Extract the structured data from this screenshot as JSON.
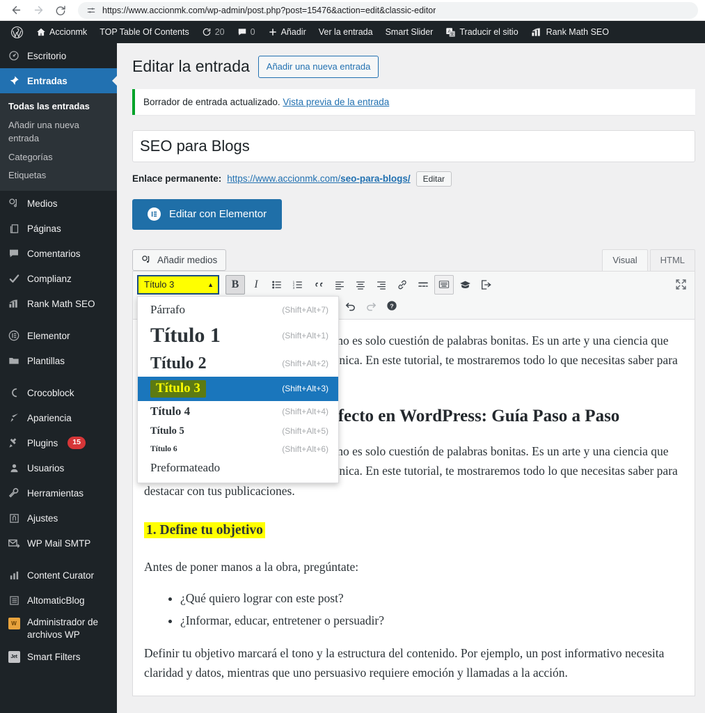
{
  "browser": {
    "url": "https://www.accionmk.com/wp-admin/post.php?post=15476&action=edit&classic-editor",
    "back_icon": "arrow-left-icon",
    "forward_icon": "arrow-right-icon",
    "reload_icon": "reload-icon",
    "site_settings_icon": "site-settings-icon"
  },
  "adminbar": {
    "items": [
      {
        "label": "",
        "icon": "wordpress-logo-icon"
      },
      {
        "label": "Accionmk",
        "icon": "home-icon"
      },
      {
        "label": "TOP Table Of Contents",
        "icon": ""
      },
      {
        "label": "20",
        "icon": "update-icon"
      },
      {
        "label": "0",
        "icon": "comment-icon"
      },
      {
        "label": "Añadir",
        "icon": "plus-icon"
      },
      {
        "label": "Ver la entrada",
        "icon": ""
      },
      {
        "label": "Smart Slider",
        "icon": ""
      },
      {
        "label": "Traducir el sitio",
        "icon": "translate-icon"
      },
      {
        "label": "Rank Math SEO",
        "icon": "rankmath-icon"
      }
    ]
  },
  "sidebar": {
    "items": [
      {
        "label": "Escritorio",
        "icon": "dashboard-icon"
      },
      {
        "label": "Entradas",
        "icon": "pin-icon",
        "current": true
      },
      {
        "label": "Medios",
        "icon": "media-icon"
      },
      {
        "label": "Páginas",
        "icon": "pages-icon"
      },
      {
        "label": "Comentarios",
        "icon": "comment-icon"
      },
      {
        "label": "Complianz",
        "icon": "check-icon"
      },
      {
        "label": "Rank Math SEO",
        "icon": "rankmath-icon"
      },
      {
        "label": "Elementor",
        "icon": "elementor-icon"
      },
      {
        "label": "Plantillas",
        "icon": "folder-icon"
      },
      {
        "label": "Crocoblock",
        "icon": "crocoblock-icon"
      },
      {
        "label": "Apariencia",
        "icon": "brush-icon"
      },
      {
        "label": "Plugins",
        "icon": "plug-icon",
        "badge": "15"
      },
      {
        "label": "Usuarios",
        "icon": "user-icon"
      },
      {
        "label": "Herramientas",
        "icon": "wrench-icon"
      },
      {
        "label": "Ajustes",
        "icon": "settings-icon"
      },
      {
        "label": "WP Mail SMTP",
        "icon": "mail-icon"
      },
      {
        "label": "Content Curator",
        "icon": "bars-chart-icon"
      },
      {
        "label": "AltomaticBlog",
        "icon": "list-icon"
      },
      {
        "label": "Administrador de archivos WP",
        "icon": "wp-folder-icon"
      },
      {
        "label": "Smart Filters",
        "icon": "jet-icon"
      }
    ],
    "submenu": [
      {
        "label": "Todas las entradas",
        "current": true
      },
      {
        "label": "Añadir una nueva entrada"
      },
      {
        "label": "Categorías"
      },
      {
        "label": "Etiquetas"
      }
    ]
  },
  "page": {
    "title": "Editar la entrada",
    "add_new_button": "Añadir una nueva entrada",
    "notice_text": "Borrador de entrada actualizado.",
    "notice_link": "Vista previa de la entrada",
    "post_title": "SEO para Blogs",
    "permalink_label": "Enlace permanente:",
    "permalink_prefix": "https://www.accionmk.com/",
    "permalink_slug": "seo-para-blogs/",
    "permalink_edit_button": "Editar",
    "elementor_button": "Editar con Elementor"
  },
  "editor": {
    "add_media_button": "Añadir medios",
    "tabs": [
      {
        "label": "Visual",
        "active": true
      },
      {
        "label": "HTML",
        "active": false
      }
    ],
    "format_select_value": "Título 3",
    "format_options": [
      {
        "label": "Párrafo",
        "shortcut": "(Shift+Alt+7)",
        "style": "o-para",
        "selected": false
      },
      {
        "label": "Título 1",
        "shortcut": "(Shift+Alt+1)",
        "style": "o-h1",
        "selected": false
      },
      {
        "label": "Título 2",
        "shortcut": "(Shift+Alt+2)",
        "style": "o-h2",
        "selected": false
      },
      {
        "label": "Título 3",
        "shortcut": "(Shift+Alt+3)",
        "style": "o-h3",
        "selected": true
      },
      {
        "label": "Título 4",
        "shortcut": "(Shift+Alt+4)",
        "style": "o-h4",
        "selected": false
      },
      {
        "label": "Título 5",
        "shortcut": "(Shift+Alt+5)",
        "style": "o-h5",
        "selected": false
      },
      {
        "label": "Título 6",
        "shortcut": "(Shift+Alt+6)",
        "style": "o-h6",
        "selected": false
      },
      {
        "label": "Preformateado",
        "shortcut": "",
        "style": "o-pre",
        "selected": false
      }
    ],
    "toolbar_icons": [
      "bold-icon",
      "italic-icon",
      "bulleted-list-icon",
      "numbered-list-icon",
      "blockquote-icon",
      "align-left-icon",
      "align-center-icon",
      "align-right-icon",
      "link-icon",
      "read-more-icon",
      "toolbar-toggle-icon",
      "graduation-cap-icon",
      "logout-icon",
      "fullscreen-icon"
    ],
    "toolbar_row2_icons": [
      "undo-icon",
      "redo-icon",
      "help-icon"
    ]
  },
  "content": {
    "paragraph_1": "Escribir un post perfecto en WordPress no es solo cuestión de palabras bonitas. Es un arte y una ciencia que combina creatividad, planificación y técnica. En este tutorial, te mostraremos todo lo que necesitas saber para destacar con tus publicaciones.",
    "heading_2": "Cómo escribir un post perfecto en WordPress: Guía Paso a Paso",
    "paragraph_2": "Escribir un post perfecto en WordPress no es solo cuestión de palabras bonitas. Es un arte y una ciencia que combina creatividad, planificación y técnica. En este tutorial, te mostraremos todo lo que necesitas saber para destacar con tus publicaciones.",
    "heading_3": "1. Define tu objetivo",
    "paragraph_3": "Antes de poner manos a la obra, pregúntate:",
    "bullets": [
      "¿Qué quiero lograr con este post?",
      "¿Informar, educar, entretener o persuadir?"
    ],
    "paragraph_4": "Definir tu objetivo marcará el tono y la estructura del contenido. Por ejemplo, un post informativo necesita claridad y datos, mientras que uno persuasivo requiere emoción y llamadas a la acción."
  },
  "colors": {
    "admin_dark": "#1d2327",
    "wp_blue": "#2271b1",
    "notice_green": "#00a32a",
    "highlight_yellow": "#ffff00",
    "selected_blue": "#1a76bc",
    "mark_green": "#5c7a12",
    "badge_red": "#d63638",
    "elementor_blue": "#1f6fa8"
  }
}
